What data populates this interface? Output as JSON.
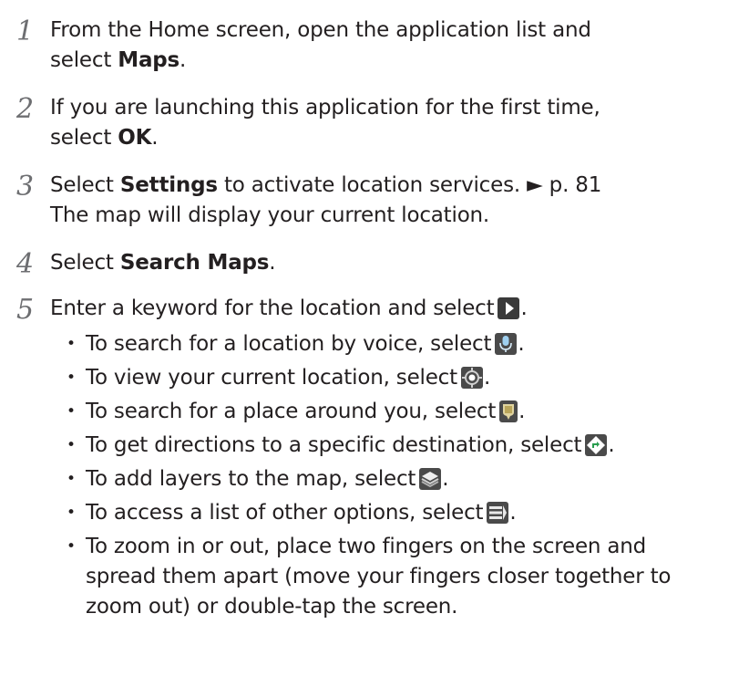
{
  "steps": [
    {
      "number": "1",
      "lines": [
        "From the Home screen, open the application list and",
        "select",
        "Maps",
        "."
      ]
    },
    {
      "number": "2",
      "lines": [
        "If you are launching this application for the first time,",
        "select",
        "OK",
        "."
      ]
    },
    {
      "number": "3",
      "lines": [
        "Select",
        "Settings",
        "to activate location services. ► p. 81",
        "The map will display your current location."
      ]
    },
    {
      "number": "4",
      "lines": [
        "Select",
        "Search Maps",
        "."
      ]
    },
    {
      "number": "5",
      "lines": [
        "Enter a keyword for the location and select",
        "."
      ]
    }
  ],
  "bullets": [
    {
      "text": "To search for a location by voice, select",
      "icon": "microphone-icon",
      "end": "."
    },
    {
      "text": "To view your current location, select",
      "icon": "my-location-icon",
      "end": "."
    },
    {
      "text": "To search for a place around you, select",
      "icon": "places-icon",
      "end": "."
    },
    {
      "text": "To get directions to a specific destination, select",
      "icon": "directions-icon",
      "end": "."
    },
    {
      "text": "To add layers to the map, select",
      "icon": "layers-icon",
      "end": "."
    },
    {
      "text": "To access a list of other options, select",
      "icon": "menu-icon",
      "end": "."
    }
  ],
  "last_bullet": [
    "To zoom in or out, place two fingers on the screen and",
    "spread them apart (move your fingers closer together to",
    "zoom out) or double-tap the screen."
  ],
  "bullet_char": "•",
  "colors": {
    "text": "#231f20",
    "step_number": "#6d6e71",
    "icon_bg": "#4a4a4a"
  }
}
